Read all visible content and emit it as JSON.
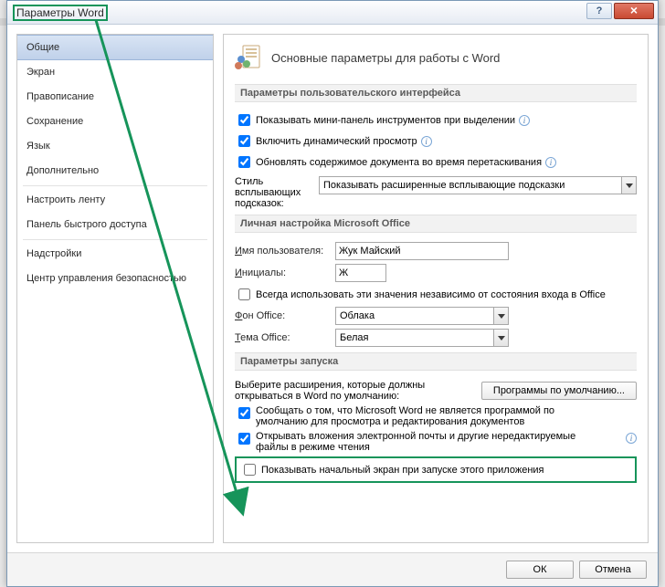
{
  "window": {
    "title": "Параметры Word",
    "help_symbol": "?",
    "close_symbol": "×"
  },
  "sidebar": {
    "items": [
      {
        "label": "Общие",
        "selected": true
      },
      {
        "label": "Экран"
      },
      {
        "label": "Правописание"
      },
      {
        "label": "Сохранение"
      },
      {
        "label": "Язык"
      },
      {
        "label": "Дополнительно"
      },
      {
        "label": "Настроить ленту"
      },
      {
        "label": "Панель быстрого доступа"
      },
      {
        "label": "Надстройки"
      },
      {
        "label": "Центр управления безопасностью"
      }
    ]
  },
  "main": {
    "heading": "Основные параметры для работы с Word"
  },
  "sec_ui": {
    "title": "Параметры пользовательского интерфейса",
    "cb_mini_toolbar": "Показывать мини-панель инструментов при выделении",
    "cb_live_preview": "Включить динамический просмотр",
    "cb_update_drag": "Обновлять содержимое документа во время перетаскивания",
    "tooltip_label_l1": "Стиль",
    "tooltip_label_l2": "всплывающих",
    "tooltip_label_l3": "подсказок:",
    "tooltip_value": "Показывать расширенные всплывающие подсказки"
  },
  "sec_personal": {
    "title": "Личная настройка Microsoft Office",
    "username_label_pre": "И",
    "username_label_rest": "мя пользователя:",
    "username_value": "Жук Майский",
    "initials_label_pre": "И",
    "initials_label_rest": "нициалы:",
    "initials_value": "Ж",
    "cb_always_use": "Всегда использовать эти значения независимо от состояния входа в Office",
    "bg_label_pre": "Ф",
    "bg_label_rest": "он Office:",
    "bg_value": "Облака",
    "theme_label_pre": "Т",
    "theme_label_rest": "ема Office:",
    "theme_value": "Белая"
  },
  "sec_startup": {
    "title": "Параметры запуска",
    "ext_text_l1": "Выберите расширения, которые должны",
    "ext_text_l2": "открываться в Word по умолчанию:",
    "default_programs_btn": "Программы по умолчанию...",
    "cb_default_viewer_l1": "Сообщать о том, что Microsoft Word не является программой по",
    "cb_default_viewer_l2": "умолчанию для просмотра и редактирования документов",
    "cb_open_attachments_l1": "Открывать вложения электронной почты и другие нередактируемые",
    "cb_open_attachments_l2": "файлы в режиме чтения",
    "cb_start_screen": "Показывать начальный экран при запуске этого приложения"
  },
  "footer": {
    "ok": "ОК",
    "cancel": "Отмена"
  }
}
